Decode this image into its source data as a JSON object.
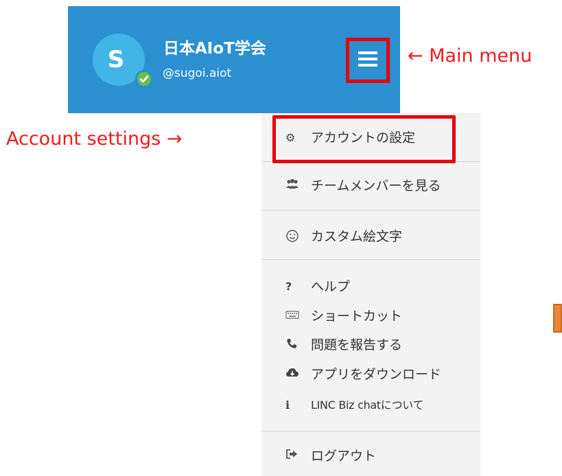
{
  "header": {
    "avatar_letter": "S",
    "team_name": "日本AIoT学会",
    "handle": "@sugoi.aiot",
    "status_icon": "check-circle-icon",
    "menu_icon": "hamburger-icon"
  },
  "annotations": {
    "main_menu": "← Main menu",
    "account_settings": "Account settings →"
  },
  "menu": {
    "items": [
      {
        "icon": "gear-icon",
        "label": "アカウントの設定"
      },
      {
        "icon": "users-icon",
        "label": "チームメンバーを見る"
      },
      {
        "icon": "smiley-icon",
        "label": "カスタム絵文字"
      },
      {
        "icon": "question-icon",
        "label": "ヘルプ"
      },
      {
        "icon": "keyboard-icon",
        "label": "ショートカット"
      },
      {
        "icon": "phone-icon",
        "label": "問題を報告する"
      },
      {
        "icon": "cloud-download-icon",
        "label": "アプリをダウンロード"
      },
      {
        "icon": "info-icon",
        "label": "LINC Biz chatについて"
      },
      {
        "icon": "sign-out-icon",
        "label": "ログアウト"
      }
    ]
  },
  "colors": {
    "header_bg": "#2b8fd0",
    "annotation_red": "#ee1c1c",
    "menu_bg": "#f3f3f3",
    "online_green": "#6cc04a"
  }
}
